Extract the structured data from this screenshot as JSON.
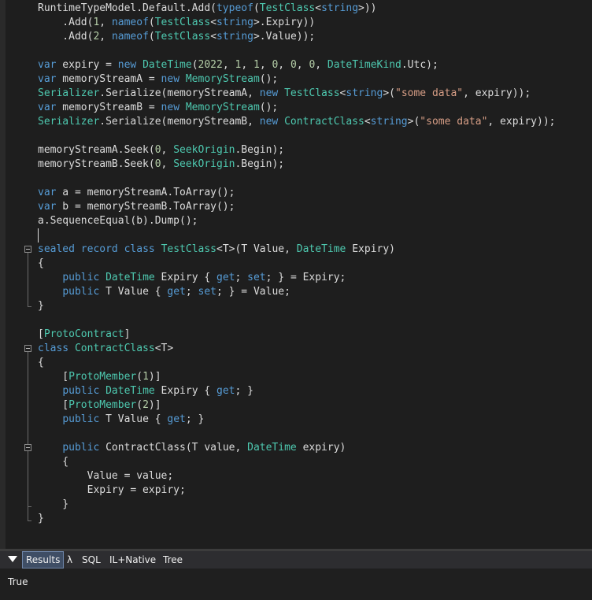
{
  "editor": {
    "lines": [
      "<span data-name=\"code-text\">RuntimeTypeModel.Default.Add(<span class=\"kw\">typeof</span>(<span class=\"ty\">TestClass</span>&lt;<span class=\"kw\">string</span>&gt;))</span>",
      "    .Add(<span class=\"nu\">1</span>, <span class=\"kw\">nameof</span>(<span class=\"ty\">TestClass</span>&lt;<span class=\"kw\">string</span>&gt;.Expiry))",
      "    .Add(<span class=\"nu\">2</span>, <span class=\"kw\">nameof</span>(<span class=\"ty\">TestClass</span>&lt;<span class=\"kw\">string</span>&gt;.Value));",
      "",
      "<span class=\"kw\">var</span> expiry = <span class=\"kw\">new</span> <span class=\"ty\">DateTime</span>(<span class=\"nu\">2022</span>, <span class=\"nu\">1</span>, <span class=\"nu\">1</span>, <span class=\"nu\">0</span>, <span class=\"nu\">0</span>, <span class=\"nu\">0</span>, <span class=\"ty\">DateTimeKind</span>.Utc);",
      "<span class=\"kw\">var</span> memoryStreamA = <span class=\"kw\">new</span> <span class=\"ty\">MemoryStream</span>();",
      "<span class=\"ty\">Serializer</span>.Serialize(memoryStreamA, <span class=\"kw\">new</span> <span class=\"ty\">TestClass</span>&lt;<span class=\"kw\">string</span>&gt;(<span class=\"st\">\"some data\"</span>, expiry));",
      "<span class=\"kw\">var</span> memoryStreamB = <span class=\"kw\">new</span> <span class=\"ty\">MemoryStream</span>();",
      "<span class=\"ty\">Serializer</span>.Serialize(memoryStreamB, <span class=\"kw\">new</span> <span class=\"ty\">ContractClass</span>&lt;<span class=\"kw\">string</span>&gt;(<span class=\"st\">\"some data\"</span>, expiry));",
      "",
      "memoryStreamA.Seek(<span class=\"nu\">0</span>, <span class=\"ty\">SeekOrigin</span>.Begin);",
      "memoryStreamB.Seek(<span class=\"nu\">0</span>, <span class=\"ty\">SeekOrigin</span>.Begin);",
      "",
      "<span class=\"kw\">var</span> a = memoryStreamA.ToArray();",
      "<span class=\"kw\">var</span> b = memoryStreamB.ToArray();",
      "a.SequenceEqual(b).Dump();",
      "",
      "<span class=\"kw\">sealed</span> <span class=\"kw\">record</span> <span class=\"kw\">class</span> <span class=\"ty\">TestClass</span>&lt;T&gt;(T Value, <span class=\"ty\">DateTime</span> Expiry)",
      "{",
      "    <span class=\"kw\">public</span> <span class=\"ty\">DateTime</span> Expiry { <span class=\"kw\">get</span>; <span class=\"kw\">set</span>; } = Expiry;",
      "    <span class=\"kw\">public</span> T Value { <span class=\"kw\">get</span>; <span class=\"kw\">set</span>; } = Value;",
      "}",
      "",
      "[<span class=\"ty\">ProtoContract</span>]",
      "<span class=\"kw\">class</span> <span class=\"ty\">ContractClass</span>&lt;T&gt;",
      "{",
      "    [<span class=\"ty\">ProtoMember</span>(<span class=\"nu\">1</span>)]",
      "    <span class=\"kw\">public</span> <span class=\"ty\">DateTime</span> Expiry { <span class=\"kw\">get</span>; }",
      "    [<span class=\"ty\">ProtoMember</span>(<span class=\"nu\">2</span>)]",
      "    <span class=\"kw\">public</span> T Value { <span class=\"kw\">get</span>; }",
      "",
      "    <span class=\"kw\">public</span> ContractClass(T value, <span class=\"ty\">DateTime</span> expiry)",
      "    {",
      "        Value = value;",
      "        Expiry = expiry;",
      "    }",
      "}"
    ],
    "plain_lines": [
      "RuntimeTypeModel.Default.Add(typeof(TestClass<string>))",
      "    .Add(1, nameof(TestClass<string>.Expiry))",
      "    .Add(2, nameof(TestClass<string>.Value));",
      "",
      "var expiry = new DateTime(2022, 1, 1, 0, 0, 0, DateTimeKind.Utc);",
      "var memoryStreamA = new MemoryStream();",
      "Serializer.Serialize(memoryStreamA, new TestClass<string>(\"some data\", expiry));",
      "var memoryStreamB = new MemoryStream();",
      "Serializer.Serialize(memoryStreamB, new ContractClass<string>(\"some data\", expiry));",
      "",
      "memoryStreamA.Seek(0, SeekOrigin.Begin);",
      "memoryStreamB.Seek(0, SeekOrigin.Begin);",
      "",
      "var a = memoryStreamA.ToArray();",
      "var b = memoryStreamB.ToArray();",
      "a.SequenceEqual(b).Dump();",
      "",
      "sealed record class TestClass<T>(T Value, DateTime Expiry)",
      "{",
      "    public DateTime Expiry { get; set; } = Expiry;",
      "    public T Value { get; set; } = Value;",
      "}",
      "",
      "[ProtoContract]",
      "class ContractClass<T>",
      "{",
      "    [ProtoMember(1)]",
      "    public DateTime Expiry { get; }",
      "    [ProtoMember(2)]",
      "    public T Value { get; }",
      "",
      "    public ContractClass(T value, DateTime expiry)",
      "    {",
      "        Value = value;",
      "        Expiry = expiry;",
      "    }",
      "}"
    ]
  },
  "results_panel": {
    "toggle_icon": "triangle-down-icon",
    "tabs": [
      {
        "label": "Results",
        "active": true
      },
      {
        "label": "λ",
        "active": false
      },
      {
        "label": "SQL",
        "active": false
      },
      {
        "label": "IL+Native",
        "active": false
      },
      {
        "label": "Tree",
        "active": false
      }
    ],
    "output": "True"
  },
  "colors": {
    "background": "#1e1e1e",
    "keyword": "#569cd6",
    "type": "#4ec9b0",
    "string": "#d69d85",
    "number": "#b5cea8",
    "active_tab": "#3f4e65"
  }
}
